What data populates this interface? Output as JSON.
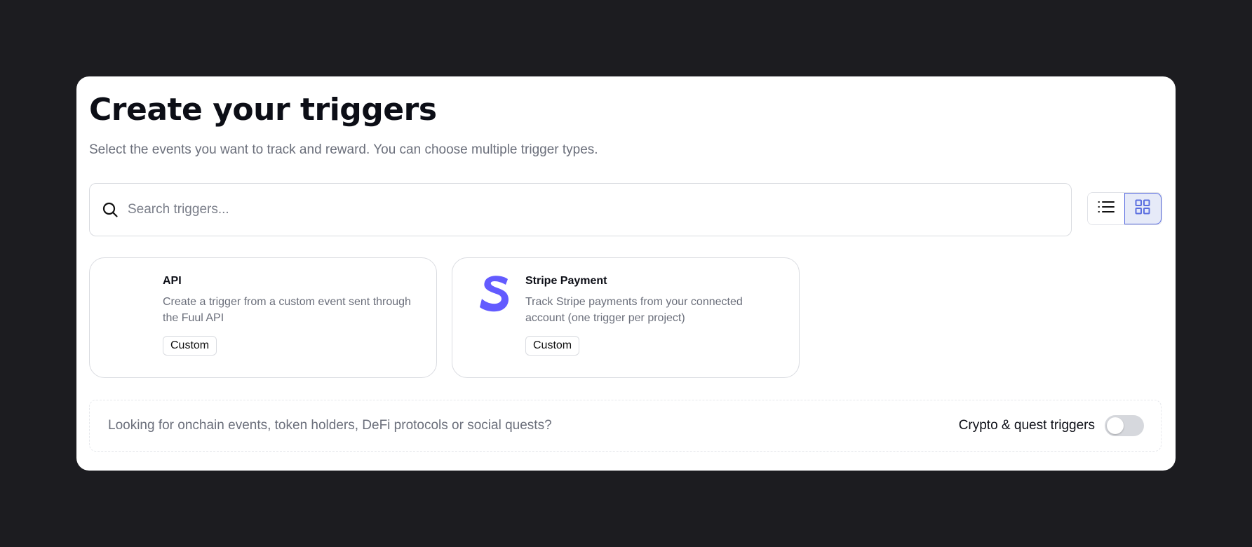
{
  "header": {
    "title": "Create your triggers",
    "subtitle": "Select the events you want to track and reward. You can choose multiple trigger types."
  },
  "search": {
    "placeholder": "Search triggers...",
    "value": "",
    "icon": "search-icon"
  },
  "view_toggle": {
    "options": [
      {
        "icon": "list-icon",
        "active": false
      },
      {
        "icon": "grid-icon",
        "active": true
      }
    ],
    "accent_color": "#5b6ee0"
  },
  "cards": [
    {
      "title": "API",
      "description": "Create a trigger from a custom event sent through the Fuul API",
      "badge": "Custom"
    },
    {
      "title": "Stripe Payment",
      "description": "Track Stripe payments from your connected account (one trigger per project)",
      "badge": "Custom",
      "logo_color": "#635bff"
    }
  ],
  "footer": {
    "text": "Looking for onchain events, token holders, DeFi protocols or social quests?",
    "toggle_label": "Crypto & quest triggers",
    "toggle_on": false
  }
}
